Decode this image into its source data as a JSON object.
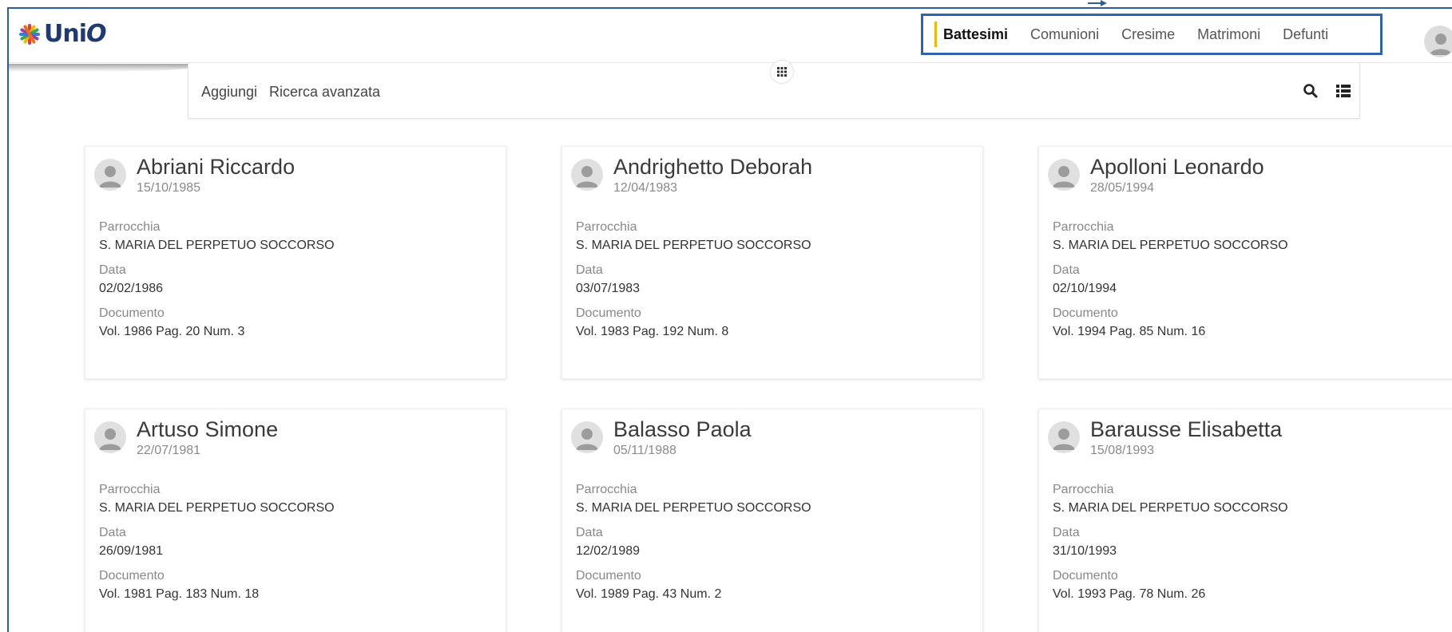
{
  "app": {
    "logo_text_a": "Uni",
    "logo_text_b": "O",
    "logo_colors": [
      "#e23b3b",
      "#f2b705",
      "#36a852",
      "#2f7fd6",
      "#8e44ad",
      "#f06a1e"
    ]
  },
  "nav": {
    "items": [
      {
        "label": "Battesimi",
        "active": true
      },
      {
        "label": "Comunioni",
        "active": false
      },
      {
        "label": "Cresime",
        "active": false
      },
      {
        "label": "Matrimoni",
        "active": false
      },
      {
        "label": "Defunti",
        "active": false
      }
    ],
    "active_accent": "#f2b705",
    "highlight_border": "#2f63ad"
  },
  "toolbar": {
    "add_label": "Aggiungi",
    "advanced_search_label": "Ricerca avanzata",
    "search_icon": "search-icon",
    "list_view_icon": "list-view-icon"
  },
  "cards": [
    {
      "name": "Abriani Riccardo",
      "dob": "15/10/1985",
      "parrocchia_label": "Parrocchia",
      "parrocchia": "S. MARIA DEL PERPETUO SOCCORSO",
      "data_label": "Data",
      "data": "02/02/1986",
      "documento_label": "Documento",
      "documento": "Vol. 1986 Pag. 20 Num. 3"
    },
    {
      "name": "Andrighetto Deborah",
      "dob": "12/04/1983",
      "parrocchia_label": "Parrocchia",
      "parrocchia": "S. MARIA DEL PERPETUO SOCCORSO",
      "data_label": "Data",
      "data": "03/07/1983",
      "documento_label": "Documento",
      "documento": "Vol. 1983 Pag. 192 Num. 8"
    },
    {
      "name": "Apolloni Leonardo",
      "dob": "28/05/1994",
      "parrocchia_label": "Parrocchia",
      "parrocchia": "S. MARIA DEL PERPETUO SOCCORSO",
      "data_label": "Data",
      "data": "02/10/1994",
      "documento_label": "Documento",
      "documento": "Vol. 1994 Pag. 85 Num. 16"
    },
    {
      "name": "Artuso Simone",
      "dob": "22/07/1981",
      "parrocchia_label": "Parrocchia",
      "parrocchia": "S. MARIA DEL PERPETUO SOCCORSO",
      "data_label": "Data",
      "data": "26/09/1981",
      "documento_label": "Documento",
      "documento": "Vol. 1981 Pag. 183 Num. 18"
    },
    {
      "name": "Balasso Paola",
      "dob": "05/11/1988",
      "parrocchia_label": "Parrocchia",
      "parrocchia": "S. MARIA DEL PERPETUO SOCCORSO",
      "data_label": "Data",
      "data": "12/02/1989",
      "documento_label": "Documento",
      "documento": "Vol. 1989 Pag. 43 Num. 2"
    },
    {
      "name": "Barausse Elisabetta",
      "dob": "15/08/1993",
      "parrocchia_label": "Parrocchia",
      "parrocchia": "S. MARIA DEL PERPETUO SOCCORSO",
      "data_label": "Data",
      "data": "31/10/1993",
      "documento_label": "Documento",
      "documento": "Vol. 1993 Pag. 78 Num. 26"
    }
  ]
}
